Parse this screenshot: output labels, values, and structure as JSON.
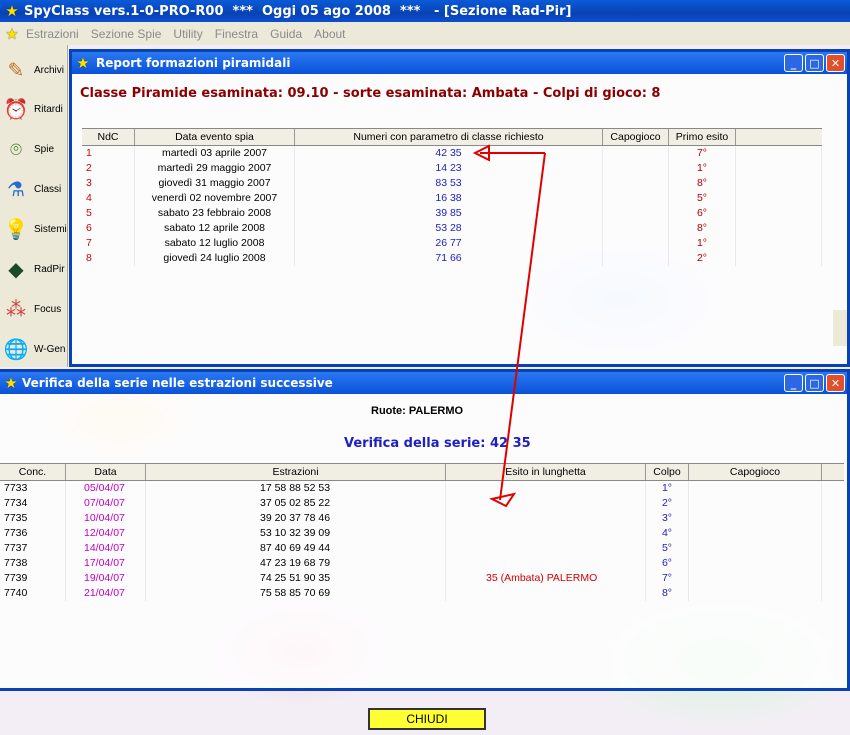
{
  "app": {
    "title": "SpyClass vers.1-0-PRO-R00  ***  Oggi 05 ago 2008  ***   - [Sezione Rad-Pir]"
  },
  "menu": [
    "Estrazioni",
    "Sezione Spie",
    "Utility",
    "Finestra",
    "Guida",
    "About"
  ],
  "sidebar": [
    {
      "label": "Archivi",
      "icon": "pencil-icon"
    },
    {
      "label": "Ritardi",
      "icon": "clock-icon"
    },
    {
      "label": "Spie",
      "icon": "binoculars-icon"
    },
    {
      "label": "Classi",
      "icon": "flask-icon"
    },
    {
      "label": "Sistemi",
      "icon": "lightbulb-icon"
    },
    {
      "label": "RadPir",
      "icon": "pyramid-icon"
    },
    {
      "label": "Focus",
      "icon": "molecule-icon"
    },
    {
      "label": "W-Gen",
      "icon": "globe-icon"
    }
  ],
  "report": {
    "title": "Report formazioni piramidali",
    "header": "Classe Piramide esaminata: 09.10 - sorte esaminata: Ambata - Colpi di gioco: 8",
    "columns": [
      "NdC",
      "Data evento spia",
      "Numeri con parametro di classe richiesto",
      "Capogioco",
      "Primo esito"
    ],
    "rows": [
      [
        "1",
        "martedì 03 aprile 2007",
        "42 35",
        "",
        "7°"
      ],
      [
        "2",
        "martedì 29 maggio 2007",
        "14 23",
        "",
        "1°"
      ],
      [
        "3",
        "giovedì 31 maggio 2007",
        "83 53",
        "",
        "8°"
      ],
      [
        "4",
        "venerdì 02 novembre 2007",
        "16 38",
        "",
        "5°"
      ],
      [
        "5",
        "sabato 23 febbraio 2008",
        "39 85",
        "",
        "6°"
      ],
      [
        "6",
        "sabato 12 aprile 2008",
        "53 28",
        "",
        "8°"
      ],
      [
        "7",
        "sabato 12 luglio 2008",
        "26 77",
        "",
        "1°"
      ],
      [
        "8",
        "giovedì 24 luglio 2008",
        "71 66",
        "",
        "2°"
      ]
    ]
  },
  "verifica": {
    "title": "Verifica della serie nelle estrazioni successive",
    "ruote": "Ruote: PALERMO",
    "serie": "Verifica della serie: 42 35",
    "columns": [
      "Conc.",
      "Data",
      "Estrazioni",
      "Esito in lunghetta",
      "Colpo",
      "Capogioco"
    ],
    "rows": [
      [
        "7733",
        "05/04/07",
        "17 58 88 52 53",
        "",
        "1°",
        ""
      ],
      [
        "7734",
        "07/04/07",
        "37 05 02 85 22",
        "",
        "2°",
        ""
      ],
      [
        "7735",
        "10/04/07",
        "39 20 37 78 46",
        "",
        "3°",
        ""
      ],
      [
        "7736",
        "12/04/07",
        "53 10 32 39 09",
        "",
        "4°",
        ""
      ],
      [
        "7737",
        "14/04/07",
        "87 40 69 49 44",
        "",
        "5°",
        ""
      ],
      [
        "7738",
        "17/04/07",
        "47 23 19 68 79",
        "",
        "6°",
        ""
      ],
      [
        "7739",
        "19/04/07",
        "74 25 51 90 35",
        "35   (Ambata) PALERMO",
        "7°",
        ""
      ],
      [
        "7740",
        "21/04/07",
        "75 58 85 70 69",
        "",
        "8°",
        ""
      ]
    ],
    "close_label": "CHIUDI"
  },
  "colors": {
    "title_blue": "#0842b4",
    "red_text": "#d00000",
    "blue_text": "#2020c0",
    "magenta_text": "#c000c0",
    "arrow": "#e00000"
  }
}
